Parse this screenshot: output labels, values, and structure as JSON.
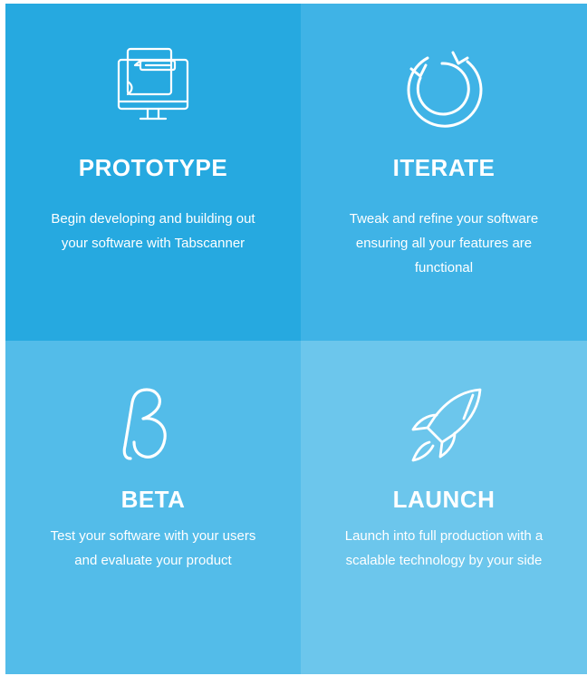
{
  "cards": [
    {
      "title": "PROTOTYPE",
      "desc": "Begin developing and building out your software with Tabscanner",
      "icon": "monitor-blueprint-icon",
      "color": "#26a9e0"
    },
    {
      "title": "ITERATE",
      "desc": "Tweak and refine your software ensuring all your features are functional",
      "icon": "refresh-cycle-icon",
      "color": "#3fb3e6"
    },
    {
      "title": "BETA",
      "desc": "Test your software with your users and evaluate your product",
      "icon": "beta-symbol-icon",
      "color": "#53bce9"
    },
    {
      "title": "LAUNCH",
      "desc": "Launch into full production with a scalable technology by your side",
      "icon": "rocket-icon",
      "color": "#6cc6ec"
    }
  ]
}
